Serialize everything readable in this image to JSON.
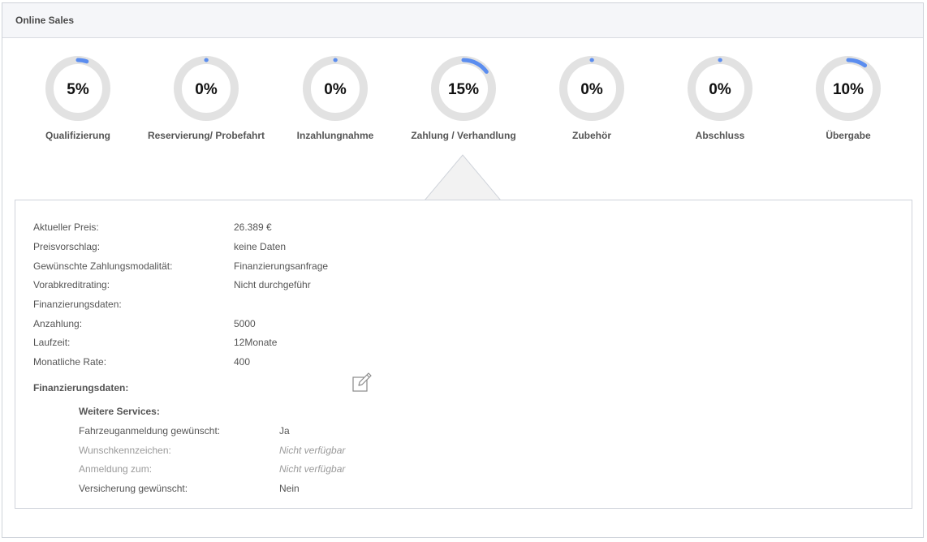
{
  "panel": {
    "title": "Online Sales"
  },
  "colors": {
    "accent": "#5b8def",
    "track": "#e2e2e2",
    "text": "#555555",
    "muted": "#9a9a9a"
  },
  "steps": [
    {
      "label": "Qualifizierung",
      "percent": 5,
      "percent_text": "5%"
    },
    {
      "label": "Reservierung/ Probefahrt",
      "percent": 0,
      "percent_text": "0%"
    },
    {
      "label": "Inzahlungnahme",
      "percent": 0,
      "percent_text": "0%"
    },
    {
      "label": "Zahlung / Verhandlung",
      "percent": 15,
      "percent_text": "15%"
    },
    {
      "label": "Zubehör",
      "percent": 0,
      "percent_text": "0%"
    },
    {
      "label": "Abschluss",
      "percent": 0,
      "percent_text": "0%"
    },
    {
      "label": "Übergabe",
      "percent": 10,
      "percent_text": "10%"
    }
  ],
  "selected_step": "Zahlung / Verhandlung",
  "details": {
    "rows": [
      {
        "label": "Aktueller Preis:",
        "value": "26.389 €"
      },
      {
        "label": "Preisvorschlag:",
        "value": "keine Daten"
      },
      {
        "label": "Gewünschte Zahlungsmodalität:",
        "value": "Finanzierungsanfrage"
      },
      {
        "label": "Vorabkreditrating:",
        "value": "Nicht durchgeführ"
      },
      {
        "label": "Finanzierungsdaten:",
        "value": ""
      },
      {
        "label": "Anzahlung:",
        "value": "5000"
      },
      {
        "label": "Laufzeit:",
        "value": "12Monate"
      },
      {
        "label": "Monatliche Rate:",
        "value": "400"
      }
    ],
    "section_title": "Finanzierungsdaten:",
    "edit_icon": "edit-icon",
    "services": {
      "title": "Weitere Services:",
      "rows": [
        {
          "label": "Fahrzeuganmeldung gewünscht:",
          "value": "Ja"
        },
        {
          "label": "Wunschkennzeichen:",
          "value": "Nicht verfügbar"
        },
        {
          "label": "Anmeldung zum:",
          "value": "Nicht verfügbar"
        },
        {
          "label": "Versicherung gewünscht:",
          "value": "Nein"
        }
      ]
    }
  }
}
